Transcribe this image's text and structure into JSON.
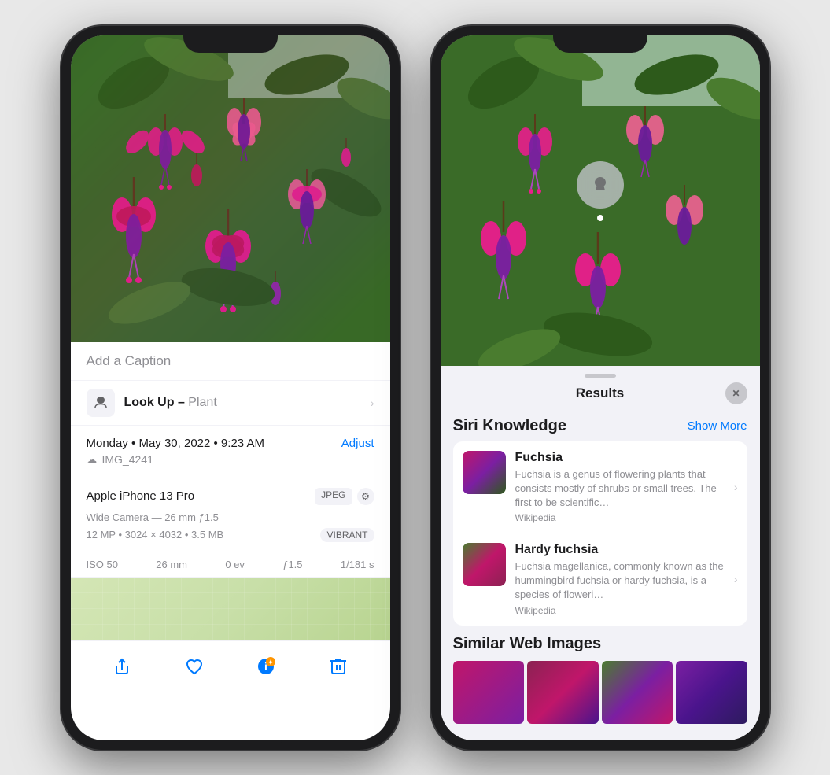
{
  "phones": {
    "left": {
      "caption_placeholder": "Add a Caption",
      "lookup": {
        "label_bold": "Look Up –",
        "label_plain": " Plant",
        "chevron": "›"
      },
      "date": {
        "text": "Monday • May 30, 2022 • 9:23 AM",
        "adjust_label": "Adjust",
        "file_name": "IMG_4241"
      },
      "camera": {
        "model": "Apple iPhone 13 Pro",
        "badge_format": "JPEG",
        "wide": "Wide Camera — 26 mm ƒ1.5",
        "mp": "12 MP • 3024 × 4032 • 3.5 MB",
        "vibrant": "VIBRANT"
      },
      "exif": {
        "iso": "ISO 50",
        "mm": "26 mm",
        "ev": "0 ev",
        "aperture": "ƒ1.5",
        "shutter": "1/181 s"
      },
      "toolbar": {
        "share": "⬆",
        "like": "♡",
        "info": "ℹ",
        "trash": "🗑"
      }
    },
    "right": {
      "sheet": {
        "title": "Results",
        "close": "✕"
      },
      "siri_knowledge": {
        "section_title": "Siri Knowledge",
        "show_more": "Show More",
        "items": [
          {
            "name": "Fuchsia",
            "description": "Fuchsia is a genus of flowering plants that consists mostly of shrubs or small trees. The first to be scientific…",
            "source": "Wikipedia"
          },
          {
            "name": "Hardy fuchsia",
            "description": "Fuchsia magellanica, commonly known as the hummingbird fuchsia or hardy fuchsia, is a species of floweri…",
            "source": "Wikipedia"
          }
        ]
      },
      "similar": {
        "section_title": "Similar Web Images"
      }
    }
  }
}
